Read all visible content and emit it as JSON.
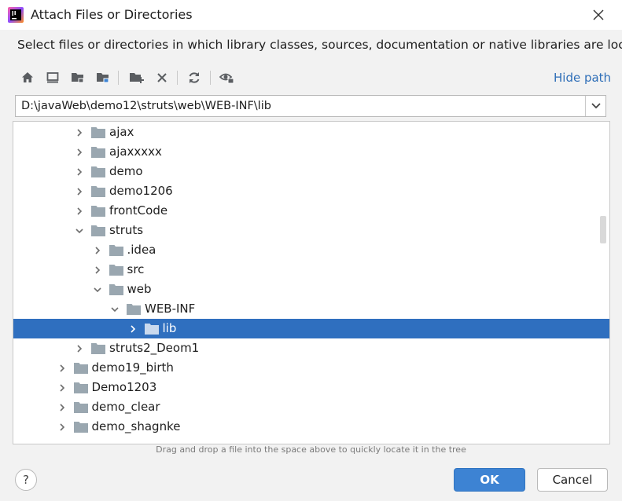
{
  "window": {
    "title": "Attach Files or Directories",
    "app_icon": "intellij-idea-icon",
    "close_icon": "close-icon"
  },
  "description": "Select files or directories in which library classes, sources, documentation or native libraries are located",
  "toolbar": {
    "buttons": [
      {
        "icon": "home-icon"
      },
      {
        "icon": "desktop-icon"
      },
      {
        "icon": "project-folder-icon"
      },
      {
        "icon": "module-folder-icon"
      },
      {
        "icon": "new-folder-icon"
      },
      {
        "icon": "delete-icon"
      },
      {
        "icon": "refresh-icon"
      },
      {
        "icon": "show-hidden-icon"
      }
    ],
    "hide_path_label": "Hide path"
  },
  "path": {
    "value": "D:\\javaWeb\\demo12\\struts\\web\\WEB-INF\\lib"
  },
  "tree": {
    "rows": [
      {
        "label": "ajax",
        "level": 3,
        "expanded": false
      },
      {
        "label": "ajaxxxxx",
        "level": 3,
        "expanded": false
      },
      {
        "label": "demo",
        "level": 3,
        "expanded": false
      },
      {
        "label": "demo1206",
        "level": 3,
        "expanded": false
      },
      {
        "label": "frontCode",
        "level": 3,
        "expanded": false
      },
      {
        "label": "struts",
        "level": 3,
        "expanded": true
      },
      {
        "label": ".idea",
        "level": 4,
        "expanded": false
      },
      {
        "label": "src",
        "level": 4,
        "expanded": false
      },
      {
        "label": "web",
        "level": 4,
        "expanded": true
      },
      {
        "label": "WEB-INF",
        "level": 5,
        "expanded": true
      },
      {
        "label": "lib",
        "level": 6,
        "expanded": false,
        "selected": true
      },
      {
        "label": "struts2_Deom1",
        "level": 3,
        "expanded": false
      },
      {
        "label": "demo19_birth",
        "level": 2,
        "expanded": false
      },
      {
        "label": "Demo1203",
        "level": 2,
        "expanded": false
      },
      {
        "label": "demo_clear",
        "level": 2,
        "expanded": false
      },
      {
        "label": "demo_shagnke",
        "level": 2,
        "expanded": false
      }
    ]
  },
  "hint": "Drag and drop a file into the space above to quickly locate it in the tree",
  "buttons": {
    "help_label": "?",
    "ok_label": "OK",
    "cancel_label": "Cancel"
  },
  "colors": {
    "selection": "#2f6fbf",
    "link": "#2f6fb8",
    "primary_button": "#3d83d3",
    "folder": "#9aa7b0"
  }
}
